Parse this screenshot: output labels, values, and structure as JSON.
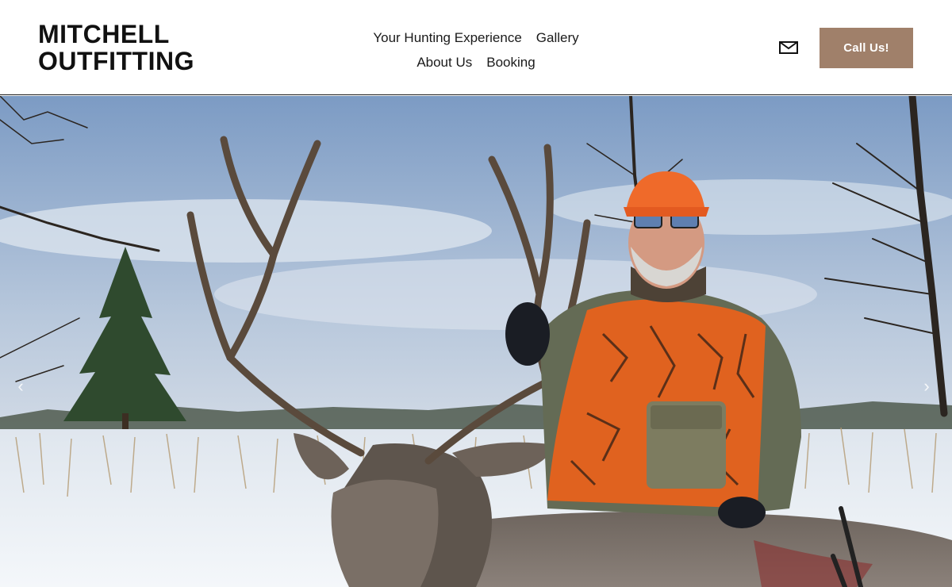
{
  "brand": {
    "line1": "MITCHELL",
    "line2": "OUTFITTING"
  },
  "nav": {
    "items": [
      {
        "label": "Your Hunting Experience"
      },
      {
        "label": "Gallery"
      },
      {
        "label": "About Us"
      },
      {
        "label": "Booking"
      }
    ]
  },
  "header": {
    "mail_icon": "envelope-icon",
    "call_label": "Call Us!"
  },
  "colors": {
    "accent": "#a0806a",
    "text": "#111111",
    "background": "#ffffff"
  },
  "hero": {
    "prev_icon": "chevron-left-icon",
    "next_icon": "chevron-right-icon",
    "prev_glyph": "‹",
    "next_glyph": "›"
  }
}
